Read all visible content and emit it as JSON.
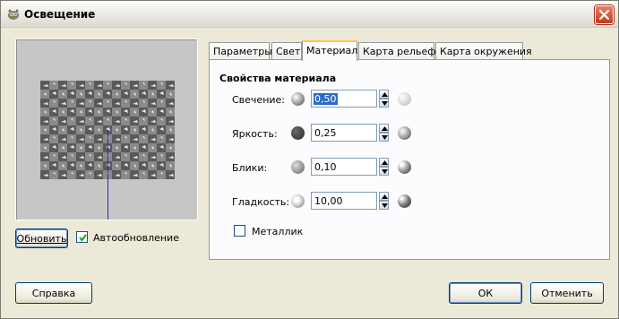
{
  "window": {
    "title": "Освещение"
  },
  "preview": {
    "update_button": "Обновить",
    "auto_update_label": "Автообновление",
    "auto_update_checked": true
  },
  "tabs": [
    {
      "label": "Параметры",
      "active": false
    },
    {
      "label": "Свет",
      "active": false
    },
    {
      "label": "Материал",
      "active": true
    },
    {
      "label": "Карта рельефа",
      "active": false
    },
    {
      "label": "Карта окружения",
      "active": false
    }
  ],
  "material": {
    "section_title": "Свойства материала",
    "properties": [
      {
        "label": "Свечение:",
        "value": "0,50",
        "left_icon": "sphere-glow-icon",
        "right_icon": "sphere-glow-bright-icon"
      },
      {
        "label": "Яркость:",
        "value": "0,25",
        "left_icon": "sphere-dark-icon",
        "right_icon": "sphere-bright-icon"
      },
      {
        "label": "Блики:",
        "value": "0,10",
        "left_icon": "sphere-dull-icon",
        "right_icon": "sphere-highlight-icon"
      },
      {
        "label": "Гладкость:",
        "value": "10,00",
        "left_icon": "sphere-soft-icon",
        "right_icon": "sphere-smooth-icon"
      }
    ],
    "metallic_label": "Металлик",
    "metallic_checked": false
  },
  "buttons": {
    "help": "Справка",
    "ok": "ОК",
    "cancel": "Отменить"
  },
  "colors": {
    "accent": "#ffc83c",
    "selection": "#316ac5",
    "close": "#c0391b"
  }
}
